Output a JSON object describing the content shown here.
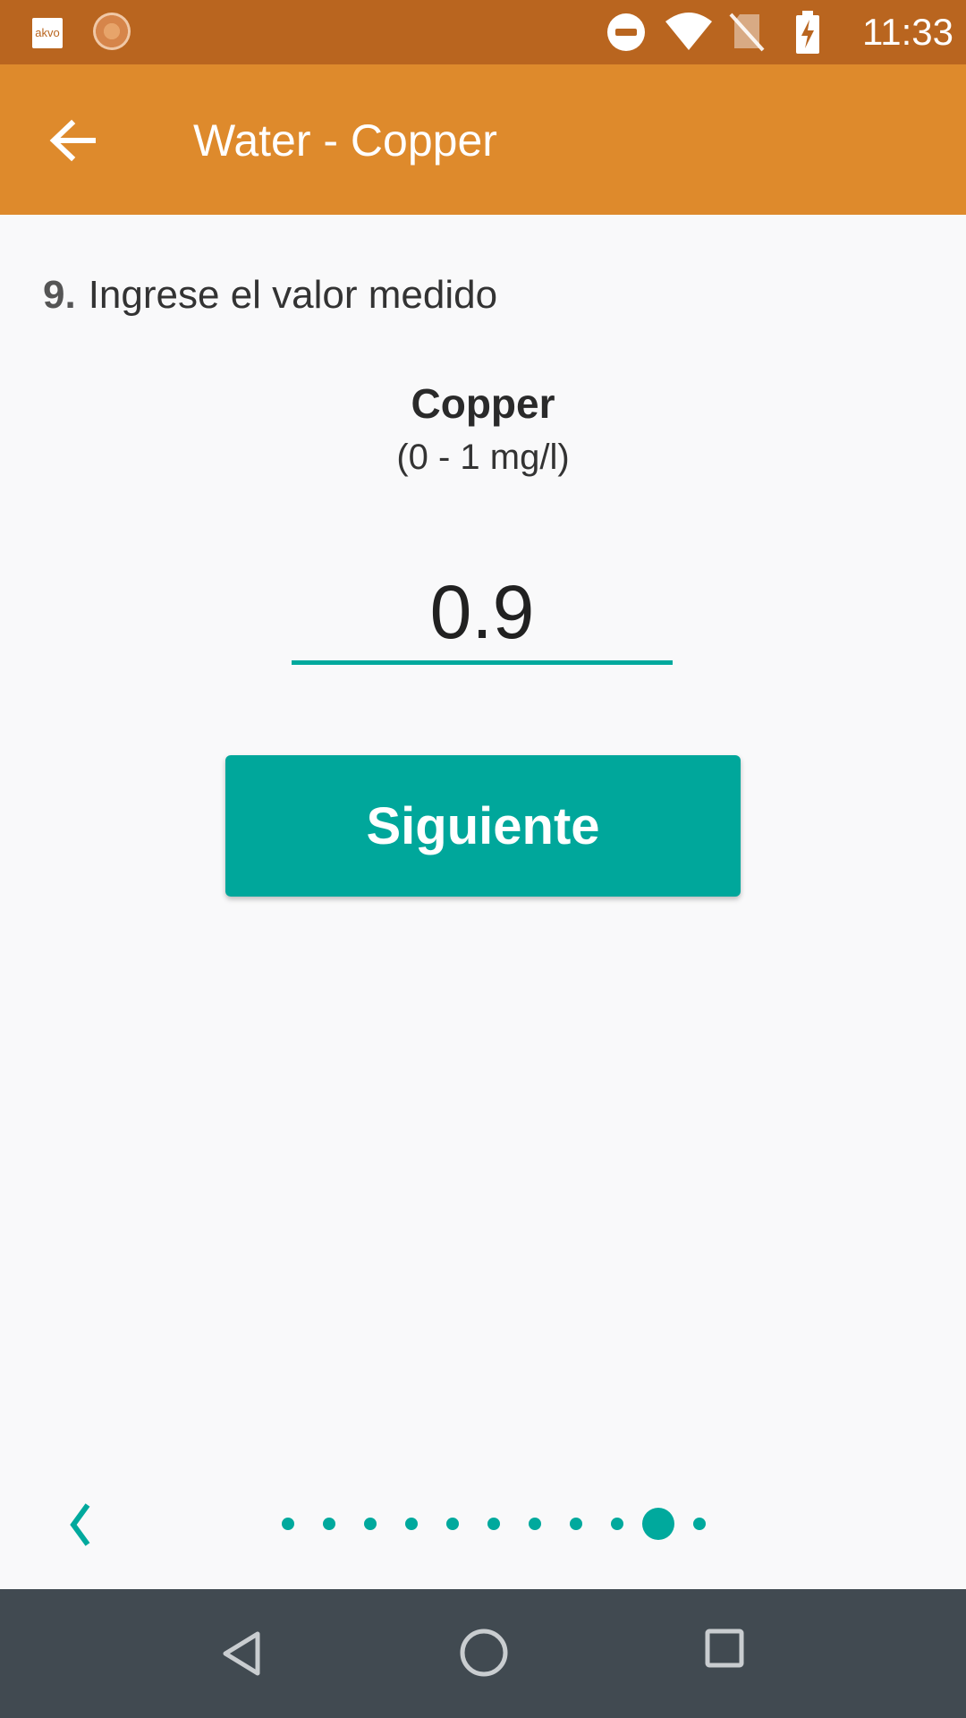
{
  "status_bar": {
    "app_icon_label": "akvo",
    "time": "11:33",
    "icons": [
      "akvo-app-icon",
      "sync-app-icon",
      "do-not-disturb-icon",
      "wifi-icon",
      "no-sim-icon",
      "battery-charging-icon"
    ]
  },
  "toolbar": {
    "title": "Water - Copper",
    "back_icon": "arrow-back-icon"
  },
  "question": {
    "number": "9.",
    "text": "Ingrese el valor medido"
  },
  "test": {
    "name": "Copper",
    "range": "(0 - 1 mg/l)"
  },
  "input": {
    "value": "0.9"
  },
  "next_button": {
    "label": "Siguiente"
  },
  "pager": {
    "total_pages": 11,
    "current_page": 10,
    "prev_icon": "chevron-left-icon"
  },
  "nav_bar": {
    "icons": [
      "nav-back-icon",
      "nav-home-icon",
      "nav-recents-icon"
    ]
  },
  "colors": {
    "status_bar": "#b9651f",
    "toolbar": "#de8a2c",
    "accent": "#00a99d",
    "nav_bar": "#414a51",
    "background": "#f9f9fa"
  }
}
